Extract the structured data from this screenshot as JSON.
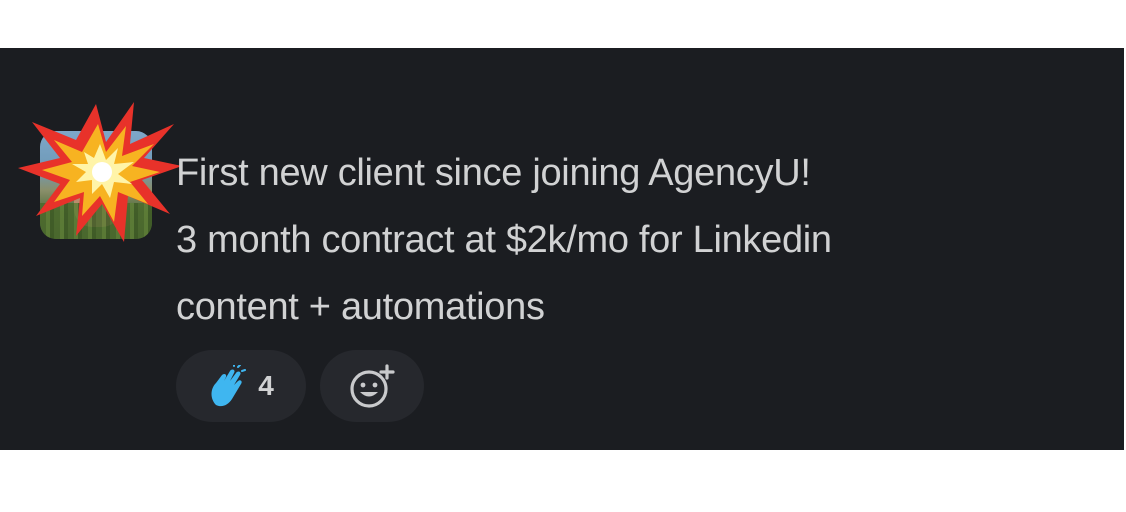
{
  "message": {
    "lines": [
      "First new client since joining AgencyU!",
      "3 month contract at $2k/mo for Linkedin",
      "content + automations"
    ]
  },
  "reactions": [
    {
      "emoji": "clap-icon",
      "count": "4"
    },
    {
      "emoji": "add-reaction-icon"
    }
  ],
  "overlay": {
    "emoji": "collision-icon"
  },
  "colors": {
    "background": "#1b1d21",
    "text": "#d1d2d3",
    "reaction_bg": "#26282d",
    "clap": "#3fb6f0"
  }
}
